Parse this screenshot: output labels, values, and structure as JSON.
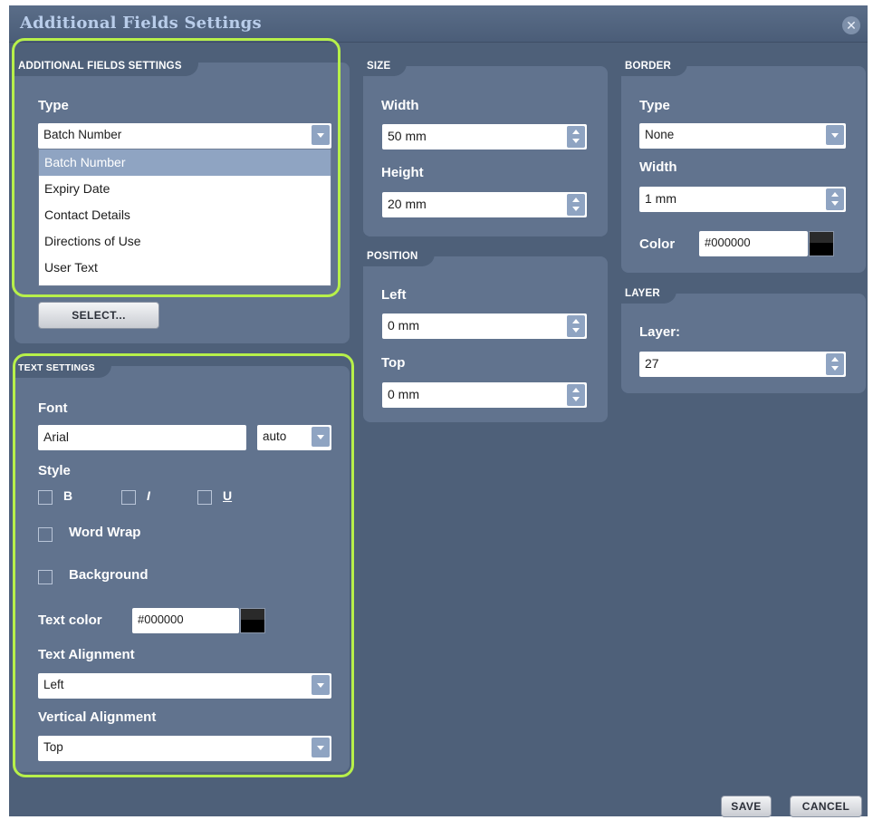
{
  "window": {
    "title": "Additional Fields Settings",
    "close_icon": "close-icon"
  },
  "additional_fields": {
    "section_title": "ADDITIONAL FIELDS SETTINGS",
    "type_label": "Type",
    "type_value": "Batch Number",
    "type_options": [
      "Batch Number",
      "Expiry Date",
      "Contact Details",
      "Directions of Use",
      "User Text"
    ],
    "select_button": "SELECT..."
  },
  "size": {
    "section_title": "SIZE",
    "width_label": "Width",
    "width_value": "50 mm",
    "height_label": "Height",
    "height_value": "20 mm"
  },
  "position": {
    "section_title": "POSITION",
    "left_label": "Left",
    "left_value": "0 mm",
    "top_label": "Top",
    "top_value": "0 mm"
  },
  "border": {
    "section_title": "BORDER",
    "type_label": "Type",
    "type_value": "None",
    "width_label": "Width",
    "width_value": "1 mm",
    "color_label": "Color",
    "color_value": "#000000"
  },
  "layer": {
    "section_title": "LAYER",
    "layer_label": "Layer:",
    "layer_value": "27"
  },
  "text_settings": {
    "section_title": "TEXT SETTINGS",
    "font_label": "Font",
    "font_value": "Arial",
    "font_size_value": "auto",
    "style_label": "Style",
    "bold_label": "B",
    "italic_label": "I",
    "underline_label": "U",
    "word_wrap_label": "Word Wrap",
    "background_label": "Background",
    "text_color_label": "Text color",
    "text_color_value": "#000000",
    "text_alignment_label": "Text Alignment",
    "text_alignment_value": "Left",
    "vertical_alignment_label": "Vertical Alignment",
    "vertical_alignment_value": "Top"
  },
  "footer": {
    "save_button": "SAVE",
    "cancel_button": "CANCEL"
  },
  "colors": {
    "dialog_bg": "#4e6079",
    "panel_bg": "#61738e",
    "highlight": "#b7f04a",
    "title_text": "#b9cdea"
  }
}
